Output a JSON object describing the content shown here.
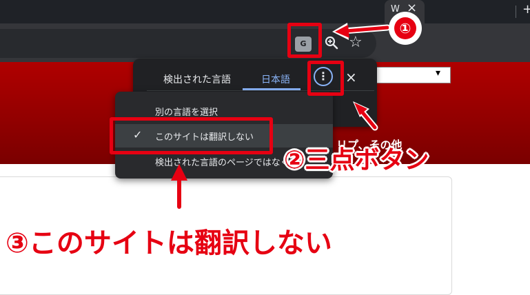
{
  "browser": {
    "tab": {
      "title": "W",
      "close_glyph": "×"
    },
    "new_tab_glyph": "+",
    "toolbar": {
      "translate_icon": "translate-icon",
      "translate_glyph": "G",
      "zoom_icon": "zoom-icon",
      "bookmark_icon": "star-icon",
      "bookmark_glyph": "☆"
    }
  },
  "page": {
    "select_arrow": "▾",
    "menu_text": "リプ、その他"
  },
  "translate_popup": {
    "tabs": [
      {
        "label": "検出された言語",
        "selected": false
      },
      {
        "label": "日本語",
        "selected": true
      }
    ],
    "more_button_glyph": "⋮",
    "close_glyph": "×"
  },
  "options_menu": {
    "items": [
      {
        "label": "別の言語を選択",
        "checked": false
      },
      {
        "label": "このサイトは翻訳しない",
        "checked": true
      },
      {
        "label": "検出された言語のページではなく",
        "checked": false
      }
    ],
    "check_glyph": "✓"
  },
  "annotations": {
    "step1": "①",
    "step2": "②三点ボタン",
    "step3": "③このサイトは翻訳しない",
    "color": "#e60012"
  }
}
